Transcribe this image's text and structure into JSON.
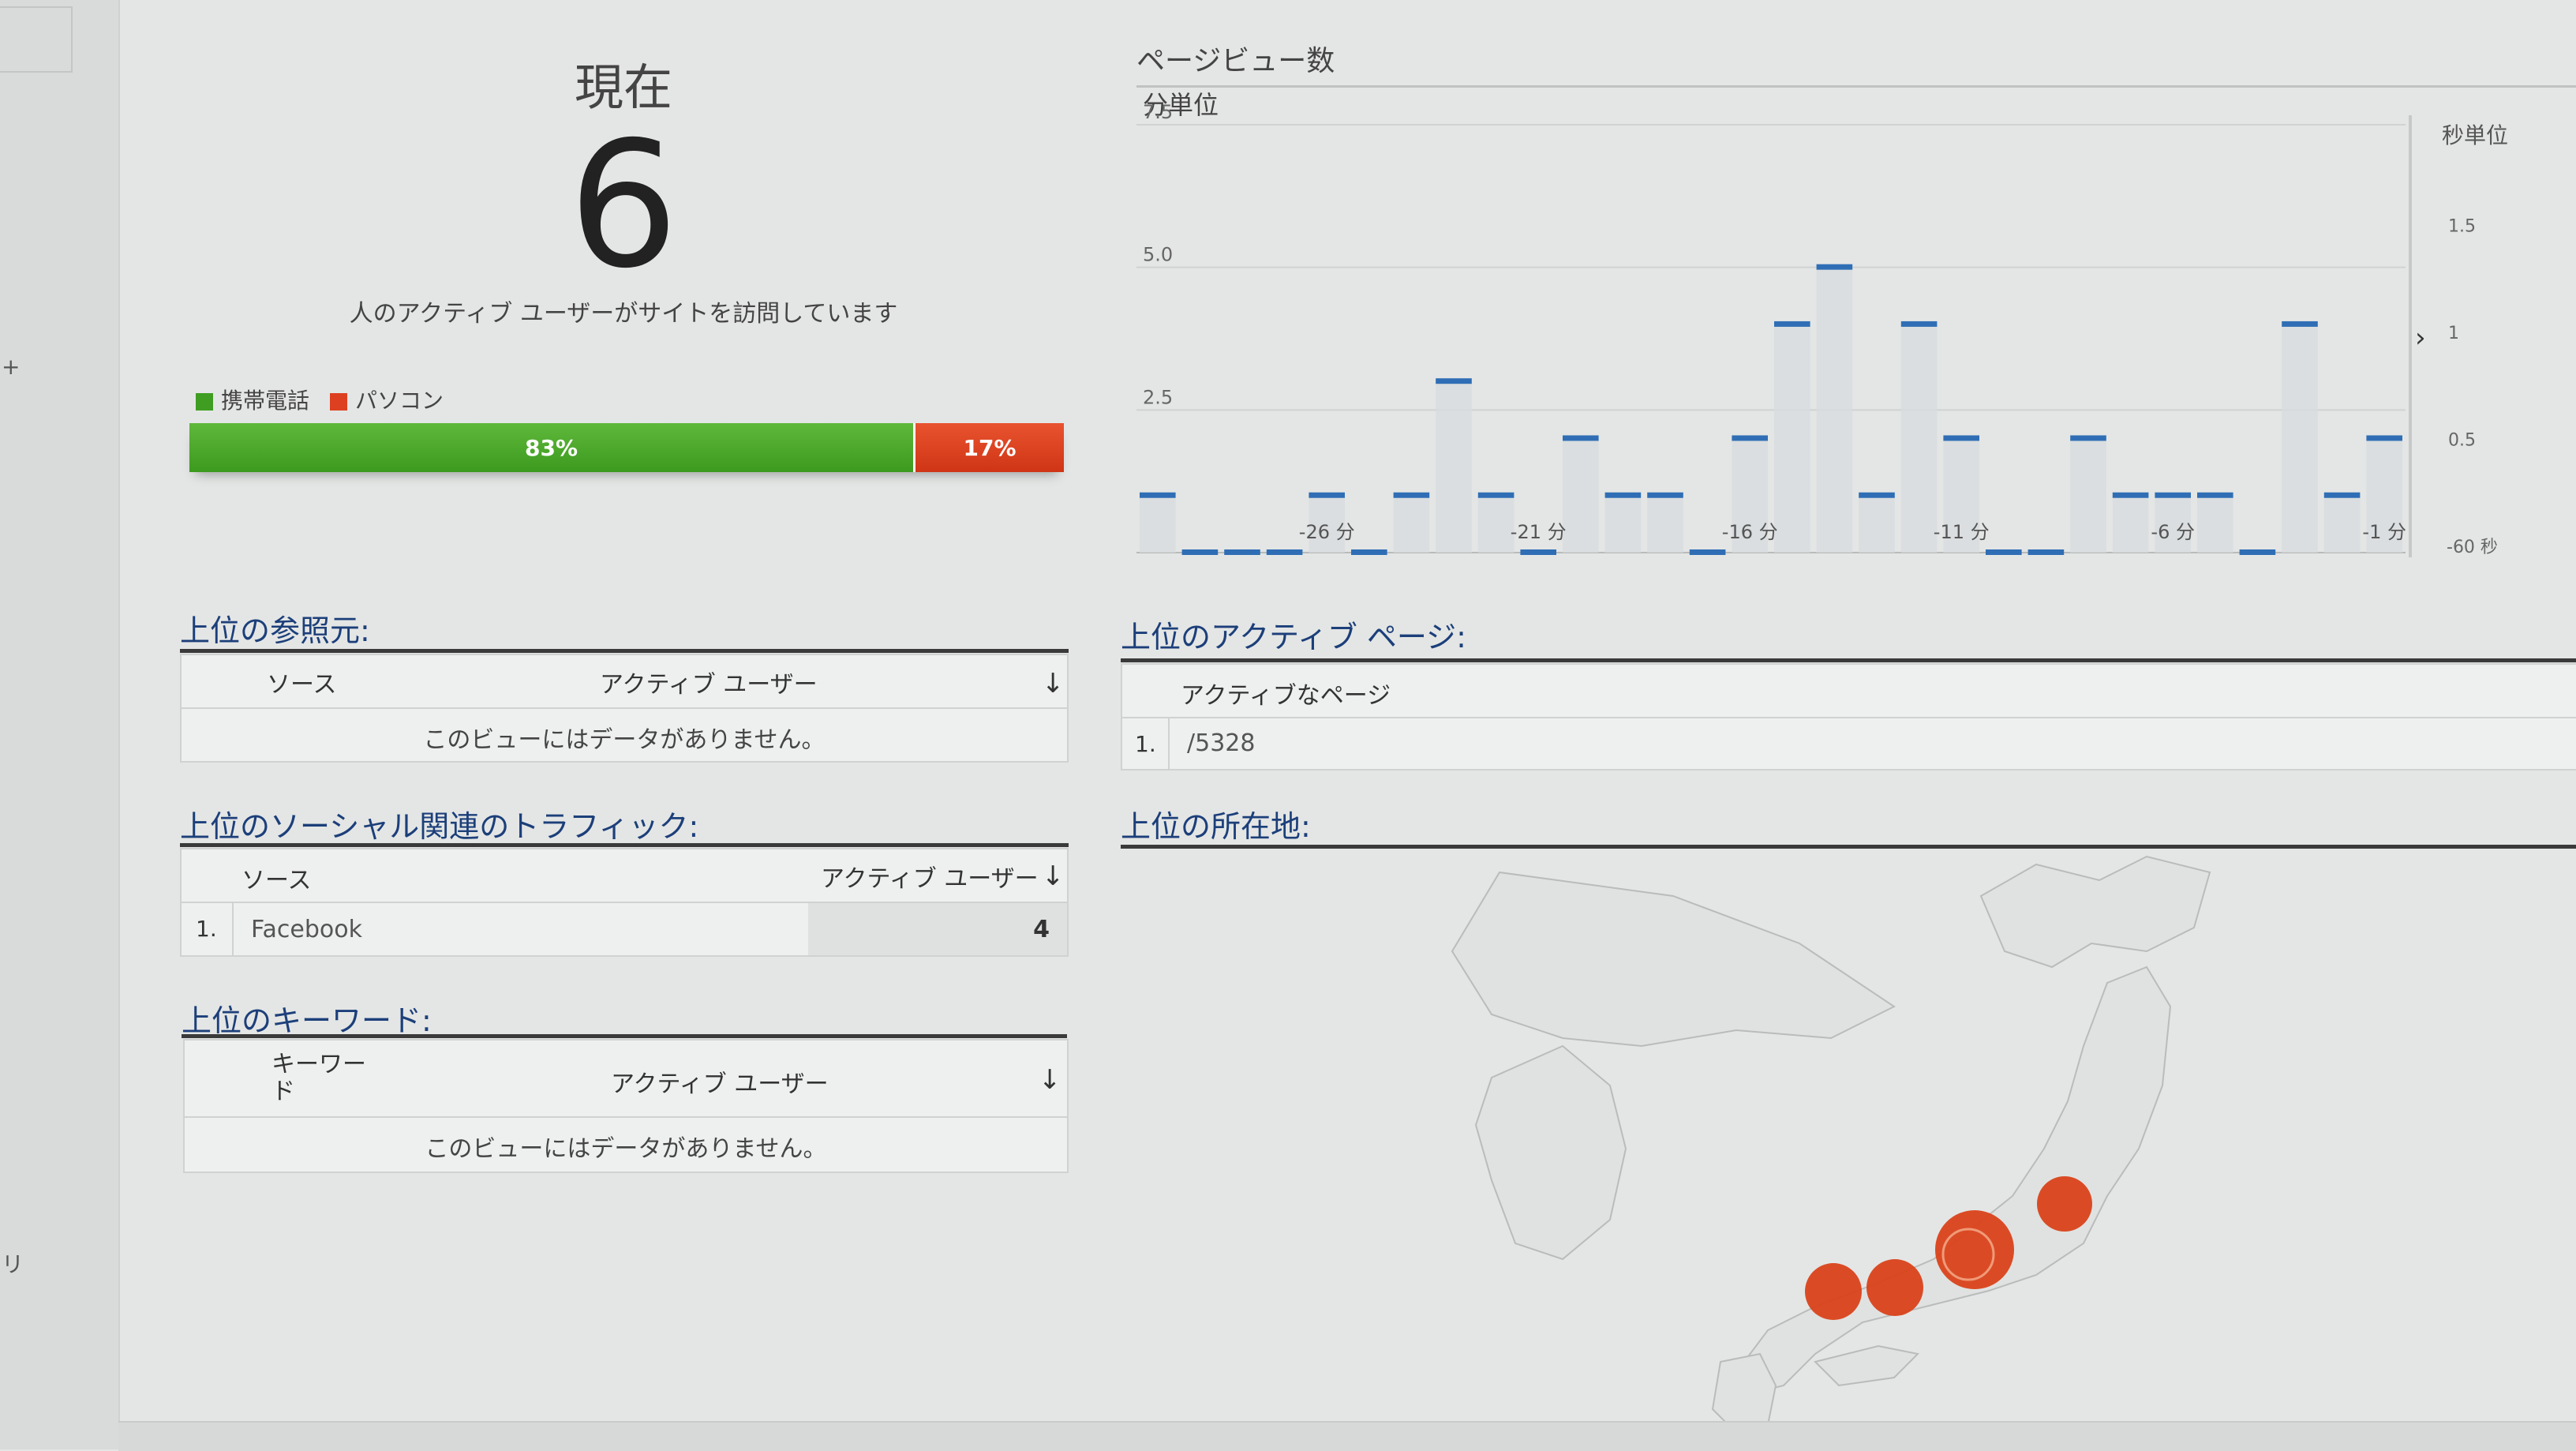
{
  "overview": {
    "title": "現在",
    "active_users": "6",
    "caption": "人のアクティブ ユーザーがサイトを訪問しています",
    "legend": [
      {
        "label": "携帯電話",
        "color": "#3f9d22"
      },
      {
        "label": "パソコン",
        "color": "#dd4020"
      }
    ],
    "devices": [
      {
        "label": "83%",
        "fraction": 0.83,
        "color": "#3f9d22"
      },
      {
        "label": "17%",
        "fraction": 0.17,
        "color": "#dd4020"
      }
    ]
  },
  "pageviews": {
    "title": "ページビュー数",
    "per_minute_label": "分単位",
    "per_second_label": "秒単位"
  },
  "chart_data": [
    {
      "type": "bar",
      "title": "",
      "subtitle": "分単位",
      "x_ticks": [
        "-26 分",
        "-21 分",
        "-16 分",
        "-11 分",
        "-6 分",
        "-1 分"
      ],
      "y_ticks": [
        "7.5",
        "5.0",
        "2.5"
      ],
      "ylim": [
        0,
        7.5
      ],
      "grid": true,
      "minutes_ago": [
        30,
        29,
        28,
        27,
        26,
        25,
        24,
        23,
        22,
        21,
        20,
        19,
        18,
        17,
        16,
        15,
        14,
        13,
        12,
        11,
        10,
        9,
        8,
        7,
        6,
        5,
        4,
        3,
        2,
        1
      ],
      "values": [
        1,
        0,
        0,
        0,
        1,
        0,
        1,
        3,
        1,
        0,
        2,
        1,
        1,
        0,
        2,
        4,
        5,
        1,
        4,
        2,
        0,
        0,
        2,
        1,
        1,
        1,
        0,
        4,
        1,
        2
      ]
    },
    {
      "type": "bar",
      "title": "",
      "subtitle": "秒単位",
      "x_ticks": [
        "-60 秒"
      ],
      "y_ticks": [
        "1.5",
        "1",
        "0.5"
      ],
      "ylim": [
        0,
        2
      ],
      "grid": false,
      "values": []
    }
  ],
  "referrers": {
    "title": "上位の参照元:",
    "col_source": "ソース",
    "col_users": "アクティブ ユーザー",
    "sort_icon": "arrow-down-icon",
    "empty": "このビューにはデータがありません。"
  },
  "social": {
    "title": "上位のソーシャル関連のトラフィック:",
    "col_source": "ソース",
    "col_users": "アクティブ ユーザー",
    "rows": [
      {
        "rank": "1.",
        "source": "Facebook",
        "users": "4"
      }
    ]
  },
  "keywords": {
    "title": "上位のキーワード:",
    "col_keyword": "キーワード",
    "col_users": "アクティブ ユーザー",
    "empty": "このビューにはデータがありません。"
  },
  "active_pages": {
    "title": "上位のアクティブ ページ:",
    "col_page": "アクティブなページ",
    "rows": [
      {
        "rank": "1.",
        "page": "/5328"
      }
    ]
  },
  "locations": {
    "title": "上位の所在地:",
    "marker_color": "#d9421a"
  }
}
